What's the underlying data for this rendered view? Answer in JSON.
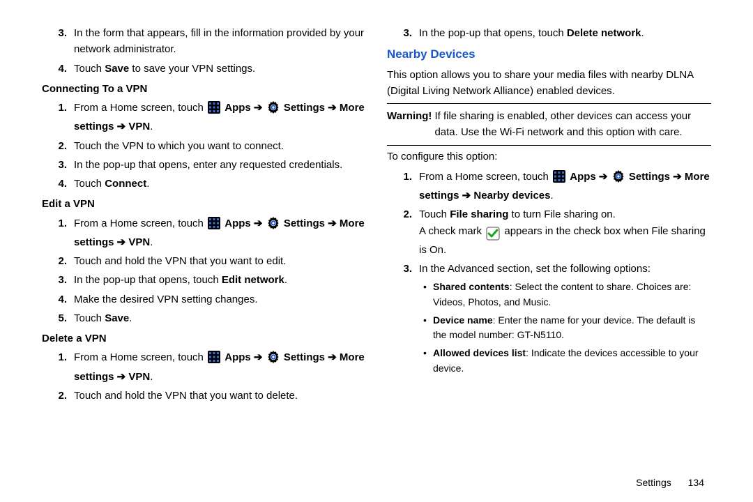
{
  "left": {
    "items_top": [
      {
        "n": "3.",
        "text": "In the form that appears, fill in the information provided by your network administrator."
      },
      {
        "n": "4.",
        "pre": "Touch ",
        "bold1": "Save",
        "post": " to save your VPN settings."
      }
    ],
    "h1": "Connecting To a VPN",
    "c1": {
      "step1_pre": "From a Home screen, touch ",
      "apps": "Apps",
      "arrow": " ➔ ",
      "settings": "Settings",
      "path": " ➔ More settings ➔ VPN",
      "step2": "Touch the VPN to which you want to connect.",
      "step3": "In the pop-up that opens, enter any requested credentials.",
      "step4_pre": "Touch ",
      "step4_bold": "Connect",
      "step4_post": "."
    },
    "h2": "Edit a VPN",
    "c2": {
      "step2": "Touch and hold the VPN that you want to edit.",
      "step3_pre": "In the pop-up that opens, touch ",
      "step3_bold": "Edit network",
      "step3_post": ".",
      "step4": "Make the desired VPN setting changes.",
      "step5_pre": "Touch ",
      "step5_bold": "Save",
      "step5_post": "."
    },
    "h3": "Delete a VPN",
    "c3": {
      "step2": "Touch and hold the VPN that you want to delete."
    }
  },
  "right": {
    "top_item": {
      "n": "3.",
      "pre": "In the pop-up that opens, touch ",
      "bold": "Delete network",
      "post": "."
    },
    "section": "Nearby Devices",
    "intro": "This option allows you to share your media files with nearby DLNA (Digital Living Network Alliance) enabled devices.",
    "warning_label": "Warning!",
    "warning_text": "If file sharing is enabled, other devices can access your data. Use the Wi-Fi network and this option with care.",
    "configure": "To configure this option:",
    "step1_path": " ➔ More settings ➔ Nearby devices",
    "step2_pre": "Touch ",
    "step2_bold": "File sharing",
    "step2_post": " to turn File sharing on.",
    "step2_note_a": "A check mark ",
    "step2_note_b": " appears in the check box when File sharing is On.",
    "step3": "In the Advanced section, set the following options:",
    "bullets": {
      "b1_bold": "Shared contents",
      "b1_text": ": Select the content to share. Choices are: Videos, Photos, and Music.",
      "b2_bold": "Device name",
      "b2_text": ": Enter the name for your device. The default is the model number: GT-N5110.",
      "b3_bold": "Allowed devices list",
      "b3_text": ": Indicate the devices accessible to your device."
    }
  },
  "footer": {
    "section": "Settings",
    "page": "134"
  }
}
